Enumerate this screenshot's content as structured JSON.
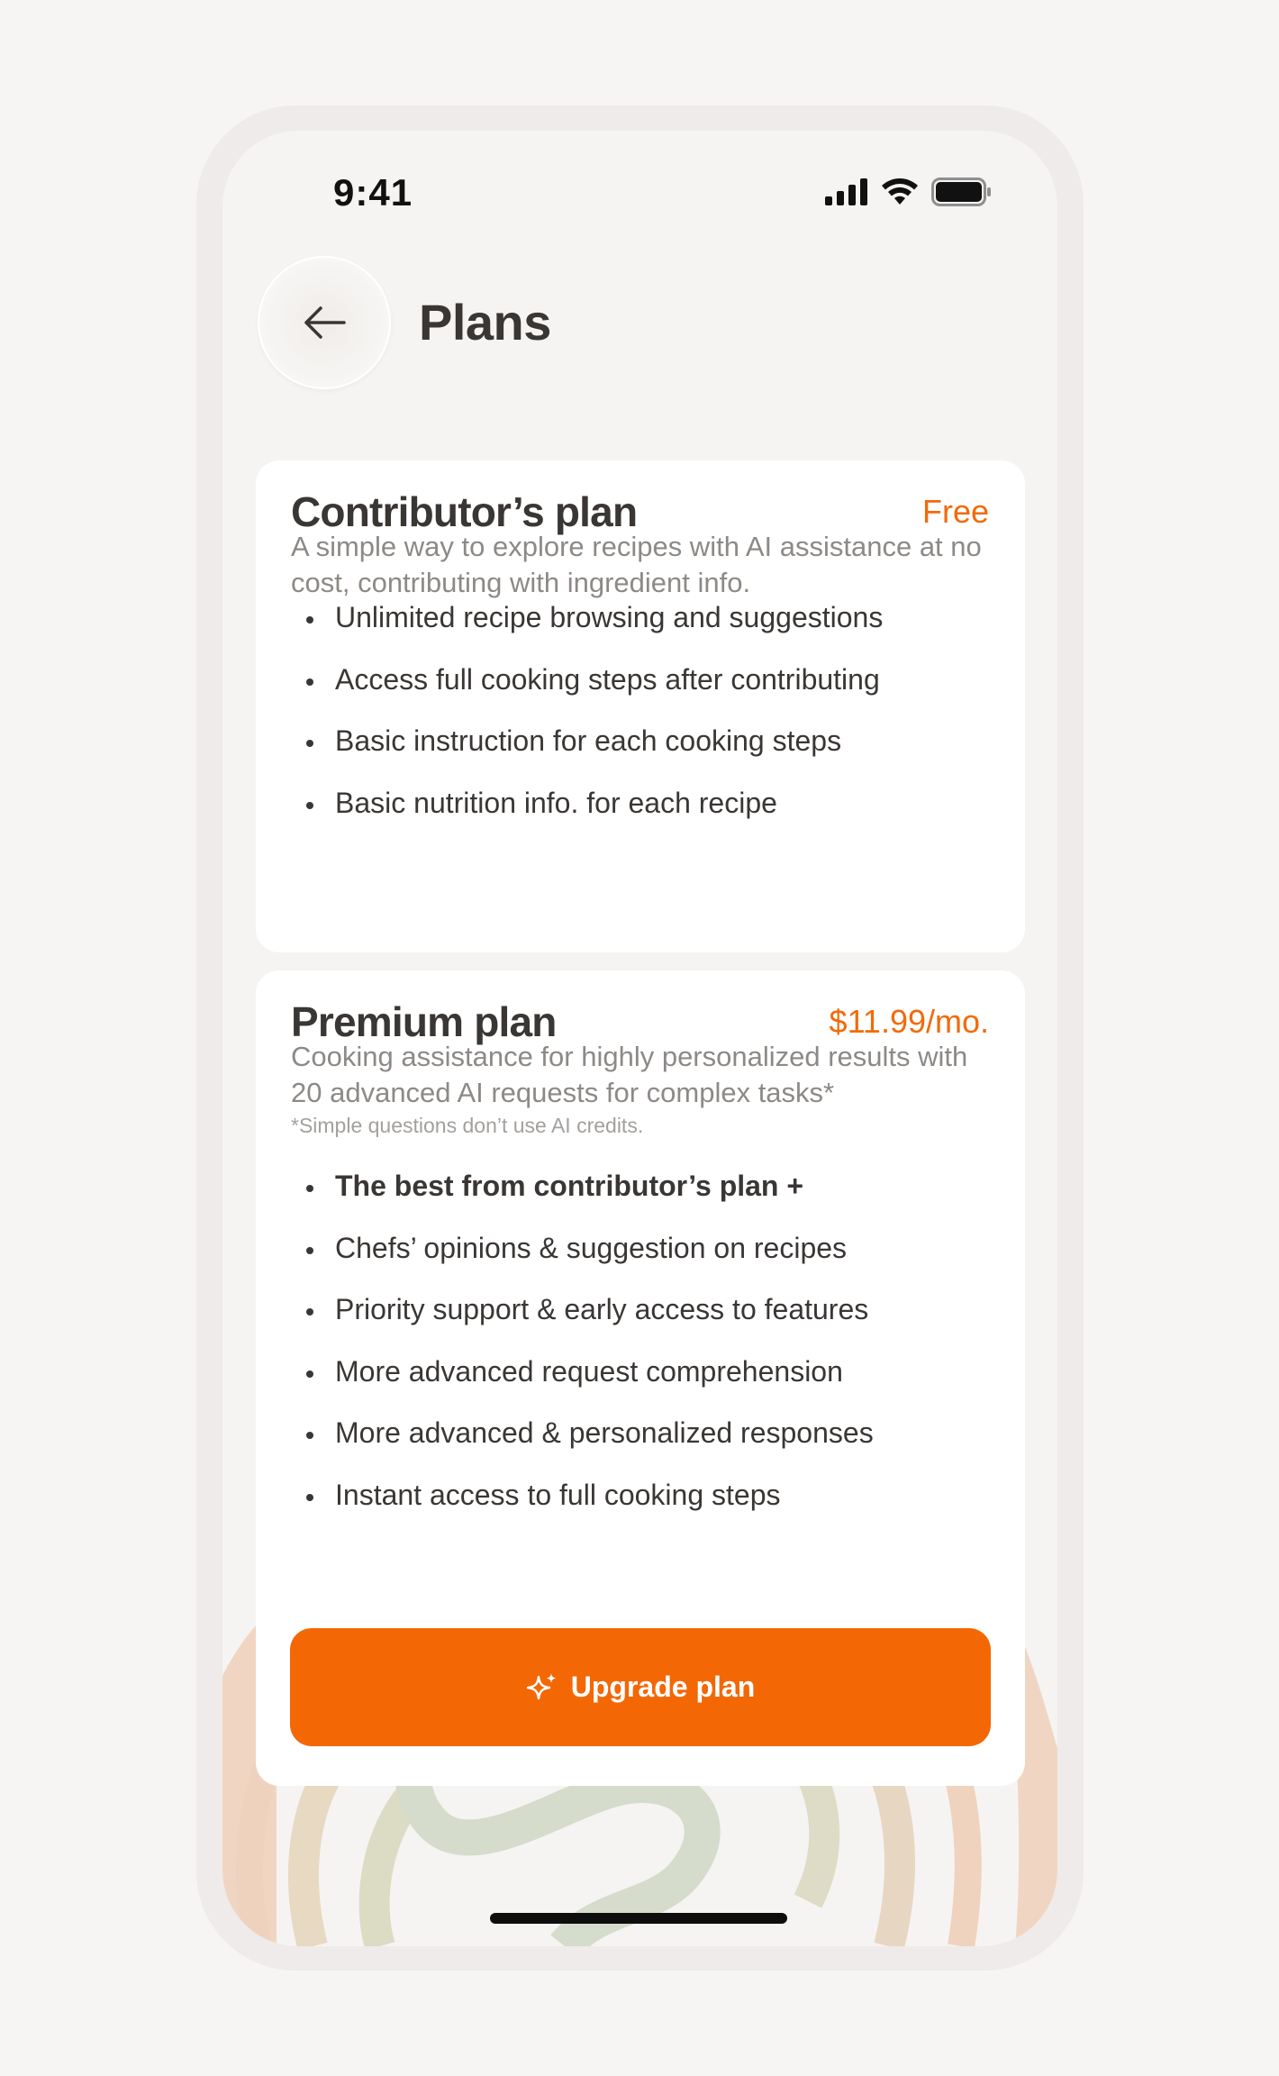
{
  "status_bar": {
    "time": "9:41"
  },
  "header": {
    "back_icon": "arrow-left-icon",
    "title": "Plans"
  },
  "plans": [
    {
      "name": "Contributor’s plan",
      "price": "Free",
      "description": "A simple way to explore recipes with AI assistance at no cost, contributing with ingredient info.",
      "features": [
        "Unlimited recipe browsing and suggestions",
        "Access full cooking steps after contributing",
        "Basic instruction for each cooking steps",
        "Basic nutrition info. for each recipe"
      ]
    },
    {
      "name": "Premium plan",
      "price": "$11.99/mo.",
      "description": "Cooking assistance for highly personalized results with 20 advanced AI requests for complex tasks*",
      "footnote": "*Simple questions don’t use AI credits.",
      "features": [
        "The best from contributor’s plan +",
        "Chefs’ opinions & suggestion on recipes",
        "Priority support & early access to features",
        "More advanced request comprehension",
        "More advanced & personalized responses",
        "Instant access to full cooking steps"
      ],
      "cta_label": "Upgrade plan",
      "cta_icon": "sparkle-icon"
    }
  ],
  "colors": {
    "accent": "#f46705",
    "price": "#f26a0a",
    "background": "#f5f4f2"
  }
}
